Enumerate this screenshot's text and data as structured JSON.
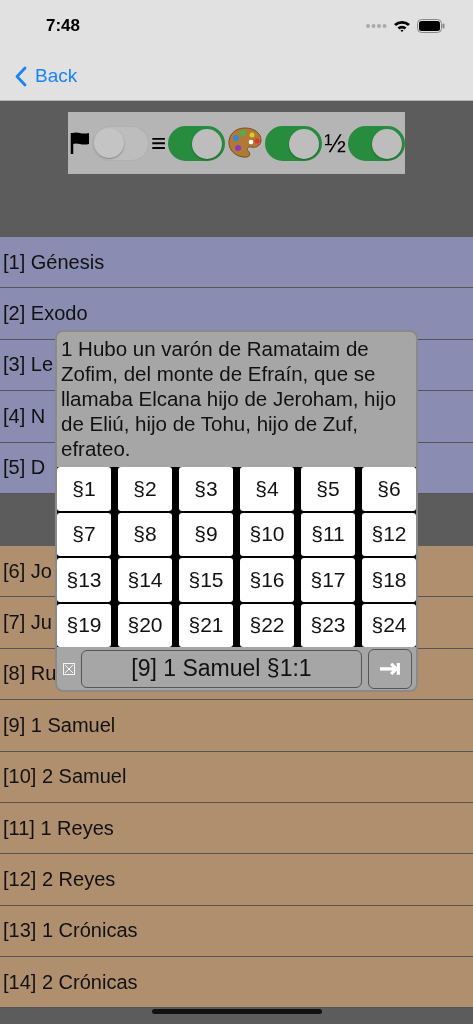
{
  "status_bar": {
    "time": "7:48"
  },
  "nav": {
    "back": "Back"
  },
  "toggles": [
    {
      "kind": "flag",
      "on": false
    },
    {
      "kind": "text",
      "label": "≡",
      "on": true
    },
    {
      "kind": "palette",
      "on": true
    },
    {
      "kind": "text",
      "label": "½",
      "on": true
    }
  ],
  "groups": [
    {
      "color": "#8b8cb1",
      "books": [
        "[1] Génesis",
        "[2] Exodo",
        "[3] Le",
        "[4] N",
        "[5] D"
      ]
    },
    {
      "color": "#b08f6e",
      "books": [
        "[6] Jo",
        "[7] Ju",
        "[8] Ru",
        "[9] 1 Samuel",
        "[10] 2 Samuel",
        "[11] 1 Reyes",
        "[12] 2 Reyes",
        "[13] 1 Crónicas",
        "[14] 2 Crónicas"
      ]
    }
  ],
  "popup": {
    "verse": "1 Hubo un varón de Ramataim de Zofim, del monte de Efraín, que se llamaba Elcana hijo de Jeroham, hijo de Eliú, hijo de Tohu, hijo de Zuf, efrateo.",
    "chapters": [
      "§1",
      "§2",
      "§3",
      "§4",
      "§5",
      "§6",
      "§7",
      "§8",
      "§9",
      "§10",
      "§11",
      "§12",
      "§13",
      "§14",
      "§15",
      "§16",
      "§17",
      "§18",
      "§19",
      "§20",
      "§21",
      "§22",
      "§23",
      "§24"
    ],
    "reference": "[9] 1 Samuel §1:1",
    "go": "⇥"
  }
}
